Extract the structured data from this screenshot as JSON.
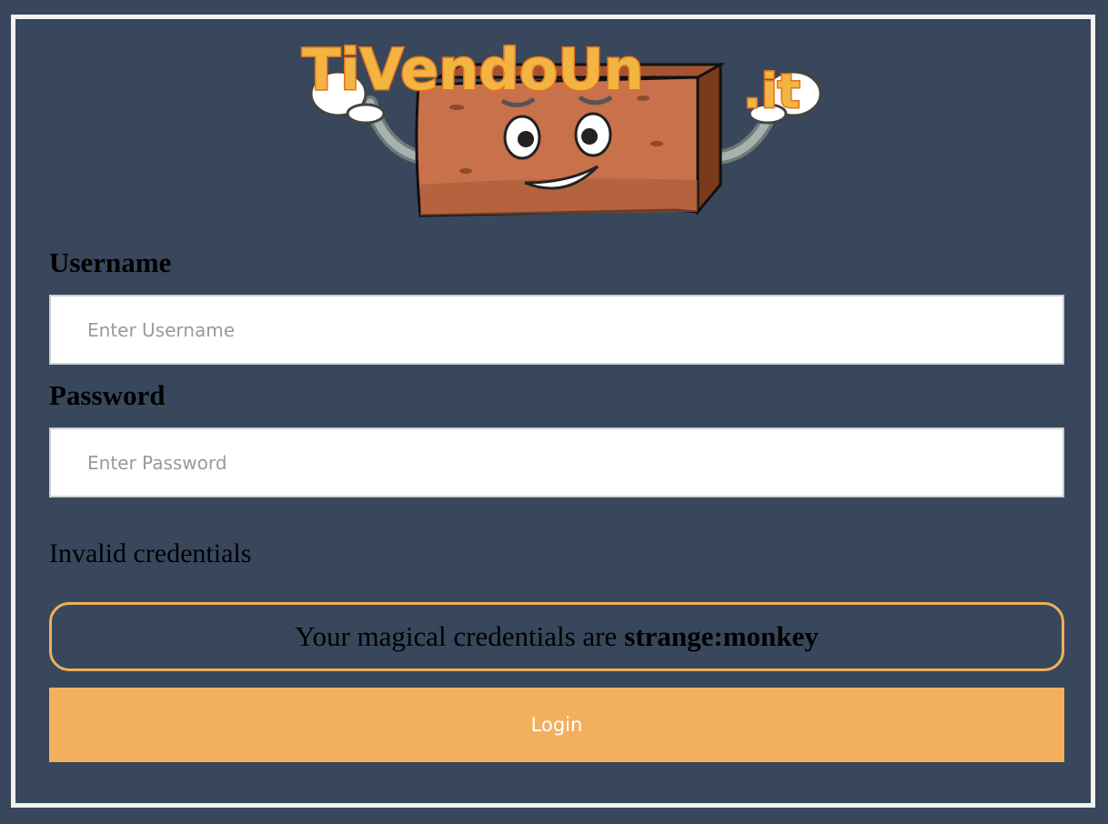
{
  "brand": {
    "logo_text": "TiVendoUn",
    "logo_suffix": ".it",
    "colors": {
      "logo_text": "#f2b442",
      "logo_outline": "#e2741c",
      "brick": "#c8714b"
    }
  },
  "form": {
    "username_label": "Username",
    "username_placeholder": "Enter Username",
    "username_value": "",
    "password_label": "Password",
    "password_placeholder": "Enter Password",
    "password_value": "",
    "error_message": "Invalid credentials",
    "hint_prefix": "Your magical credentials are",
    "hint_credentials": "strange:monkey",
    "login_label": "Login"
  },
  "colors": {
    "background": "#38475b",
    "frame_border": "#f2f2f2",
    "accent": "#f2b05c"
  }
}
